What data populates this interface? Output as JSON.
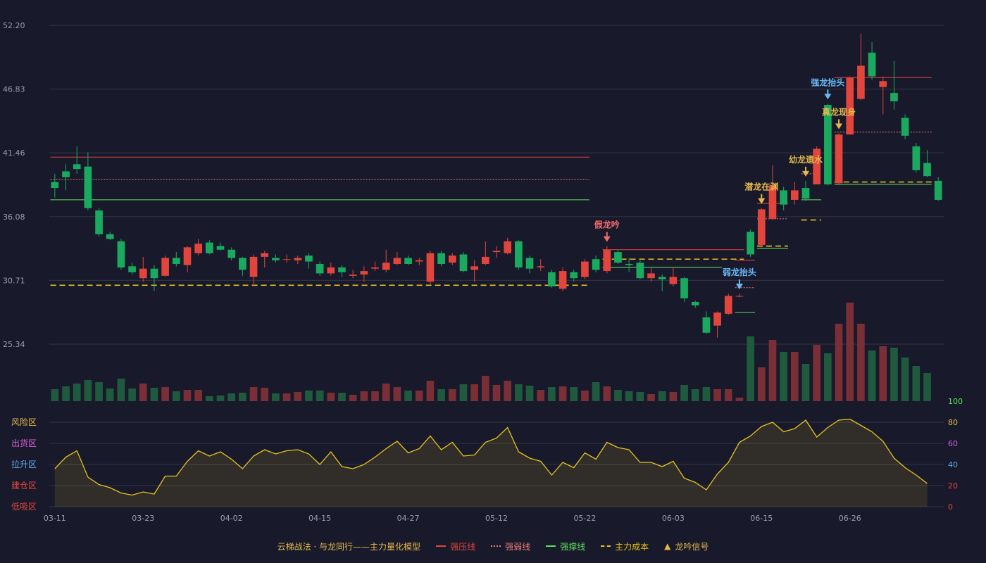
{
  "chart_data": {
    "type": "candlestick",
    "colors": {
      "up": "#e2453c",
      "down": "#1aaa5f",
      "background": "#181a2b",
      "grid": "#34374a",
      "axis_text": "#9a9db0",
      "resist": "#e2453c",
      "weak": "#f07a7a",
      "support": "#5fe05f",
      "cost": "#e8c31e",
      "osc": "#e8c31e"
    },
    "price_axis": {
      "min": 25.34,
      "max": 52.2,
      "ticks": [
        "52.20",
        "46.83",
        "41.46",
        "36.08",
        "30.71",
        "25.34"
      ]
    },
    "date_labels": [
      {
        "i": 0,
        "label": "03-11"
      },
      {
        "i": 8,
        "label": "03-23"
      },
      {
        "i": 16,
        "label": "04-02"
      },
      {
        "i": 24,
        "label": "04-15"
      },
      {
        "i": 32,
        "label": "04-27"
      },
      {
        "i": 40,
        "label": "05-12"
      },
      {
        "i": 48,
        "label": "05-22"
      },
      {
        "i": 56,
        "label": "06-03"
      },
      {
        "i": 64,
        "label": "06-15"
      },
      {
        "i": 72,
        "label": "06-26"
      }
    ],
    "candles": [
      [
        39.0,
        38.5,
        39.7,
        37.7
      ],
      [
        39.9,
        39.4,
        40.5,
        38.3
      ],
      [
        40.5,
        40.1,
        42.0,
        39.7
      ],
      [
        40.3,
        36.8,
        41.5,
        36.6
      ],
      [
        36.6,
        34.6,
        36.8,
        34.4
      ],
      [
        34.6,
        34.2,
        34.8,
        34.1
      ],
      [
        34.0,
        31.8,
        34.2,
        31.6
      ],
      [
        31.9,
        31.4,
        32.2,
        31.2
      ],
      [
        30.9,
        31.7,
        32.7,
        30.6
      ],
      [
        31.7,
        30.9,
        32.0,
        29.8
      ],
      [
        31.1,
        32.6,
        32.8,
        31.0
      ],
      [
        32.6,
        32.1,
        33.1,
        31.9
      ],
      [
        32.0,
        33.5,
        33.6,
        31.4
      ],
      [
        33.0,
        33.8,
        34.2,
        32.8
      ],
      [
        33.9,
        33.0,
        34.1,
        32.9
      ],
      [
        33.6,
        33.3,
        33.9,
        33.2
      ],
      [
        33.3,
        32.6,
        33.5,
        32.4
      ],
      [
        32.6,
        31.6,
        32.7,
        31.1
      ],
      [
        31.0,
        32.7,
        32.9,
        30.2
      ],
      [
        32.7,
        33.0,
        33.2,
        31.8
      ],
      [
        32.6,
        32.4,
        32.9,
        32.2
      ],
      [
        32.5,
        32.5,
        32.9,
        32.2
      ],
      [
        32.4,
        32.6,
        32.8,
        32.1
      ],
      [
        32.8,
        32.3,
        33.0,
        31.7
      ],
      [
        32.1,
        31.3,
        32.3,
        31.1
      ],
      [
        31.3,
        31.8,
        32.2,
        31.1
      ],
      [
        31.8,
        31.4,
        32.0,
        31.0
      ],
      [
        31.1,
        31.2,
        31.6,
        30.9
      ],
      [
        31.2,
        31.5,
        31.9,
        30.6
      ],
      [
        31.7,
        31.8,
        32.3,
        31.5
      ],
      [
        31.6,
        32.2,
        33.3,
        31.4
      ],
      [
        32.1,
        32.6,
        33.1,
        32.0
      ],
      [
        32.6,
        32.1,
        32.8,
        32.0
      ],
      [
        32.3,
        32.4,
        32.6,
        32.0
      ],
      [
        30.6,
        33.0,
        33.2,
        30.4
      ],
      [
        33.0,
        32.1,
        33.2,
        31.9
      ],
      [
        32.2,
        32.8,
        33.0,
        32.0
      ],
      [
        32.9,
        31.5,
        33.1,
        31.4
      ],
      [
        31.6,
        31.9,
        32.4,
        30.6
      ],
      [
        32.1,
        32.7,
        34.0,
        32.0
      ],
      [
        33.1,
        33.2,
        33.6,
        32.6
      ],
      [
        33.0,
        34.0,
        34.3,
        32.9
      ],
      [
        34.0,
        31.8,
        34.1,
        31.6
      ],
      [
        32.6,
        31.7,
        32.8,
        31.3
      ],
      [
        31.8,
        31.9,
        32.5,
        31.5
      ],
      [
        31.4,
        30.2,
        31.6,
        30.1
      ],
      [
        30.0,
        31.5,
        31.8,
        29.8
      ],
      [
        31.4,
        30.9,
        31.6,
        30.6
      ],
      [
        31.0,
        32.3,
        32.5,
        30.8
      ],
      [
        32.5,
        31.6,
        32.8,
        31.4
      ],
      [
        31.5,
        33.3,
        33.6,
        31.3
      ],
      [
        33.1,
        32.2,
        33.3,
        32.1
      ],
      [
        32.1,
        32.0,
        32.6,
        31.4
      ],
      [
        32.2,
        30.9,
        32.4,
        30.8
      ],
      [
        30.9,
        31.3,
        31.8,
        30.6
      ],
      [
        31.0,
        30.8,
        31.2,
        29.8
      ],
      [
        30.4,
        31.0,
        31.8,
        30.2
      ],
      [
        30.9,
        29.2,
        31.0,
        28.9
      ],
      [
        28.9,
        28.6,
        29.0,
        28.4
      ],
      [
        27.6,
        26.3,
        28.1,
        26.2
      ],
      [
        26.9,
        28.0,
        28.1,
        25.9
      ],
      [
        27.9,
        29.4,
        29.6,
        27.8
      ],
      [
        29.4,
        29.4,
        29.6,
        29.3
      ],
      [
        34.8,
        32.9,
        35.0,
        32.7
      ],
      [
        33.7,
        36.7,
        36.8,
        33.5
      ],
      [
        35.9,
        38.7,
        40.4,
        35.8
      ],
      [
        38.3,
        37.1,
        38.6,
        36.6
      ],
      [
        37.5,
        38.3,
        39.0,
        37.1
      ],
      [
        38.5,
        37.6,
        39.1,
        37.4
      ],
      [
        38.8,
        41.8,
        42.0,
        38.8
      ],
      [
        45.5,
        38.8,
        45.6,
        38.7
      ],
      [
        38.9,
        43.0,
        43.1,
        38.8
      ],
      [
        43.0,
        47.8,
        47.9,
        43.0
      ],
      [
        46.0,
        48.8,
        51.5,
        45.9
      ],
      [
        49.9,
        47.9,
        50.8,
        47.6
      ],
      [
        47.0,
        47.5,
        47.9,
        44.7
      ],
      [
        46.5,
        45.8,
        49.2,
        45.1
      ],
      [
        44.4,
        42.9,
        44.7,
        42.6
      ],
      [
        42.0,
        40.0,
        42.3,
        39.8
      ],
      [
        40.6,
        39.5,
        41.7,
        39.4
      ],
      [
        39.1,
        37.5,
        39.4,
        37.4
      ]
    ],
    "volume_heights": [
      17,
      21,
      25,
      30,
      27,
      18,
      32,
      18,
      25,
      19,
      20,
      14,
      16,
      16,
      7,
      8,
      11,
      12,
      20,
      19,
      11,
      11,
      13,
      15,
      15,
      12,
      12,
      9,
      14,
      14,
      25,
      20,
      15,
      15,
      29,
      17,
      17,
      24,
      24,
      36,
      23,
      29,
      24,
      22,
      16,
      20,
      21,
      20,
      15,
      27,
      21,
      16,
      14,
      13,
      10,
      14,
      13,
      23,
      17,
      20,
      17,
      17,
      5,
      92,
      48,
      87,
      70,
      70,
      53,
      80,
      68,
      110,
      140,
      110,
      72,
      78,
      76,
      62,
      50,
      40
    ],
    "volume_max_px": 140,
    "oscillator": {
      "axis_ticks": [
        "100",
        "80",
        "60",
        "40",
        "20",
        "0"
      ],
      "zones": [
        "风险区",
        "出货区",
        "拉升区",
        "建仓区",
        "低吸区"
      ],
      "values": [
        36,
        47,
        53,
        28,
        21,
        18,
        13,
        11,
        14,
        12,
        29,
        29,
        43,
        53,
        48,
        52,
        45,
        36,
        48,
        54,
        50,
        53,
        54,
        50,
        40,
        52,
        38,
        36,
        40,
        47,
        55,
        62,
        51,
        55,
        67,
        54,
        61,
        48,
        49,
        61,
        65,
        75,
        52,
        46,
        43,
        30,
        42,
        37,
        51,
        45,
        61,
        56,
        54,
        42,
        42,
        38,
        43,
        27,
        23,
        16,
        31,
        42,
        61,
        67,
        76,
        80,
        71,
        74,
        82,
        66,
        75,
        82,
        83,
        77,
        71,
        62,
        46,
        37,
        30,
        22
      ]
    },
    "signals": [
      {
        "i": 50,
        "label": "假龙吟",
        "color": "#f06a6a"
      },
      {
        "i": 62,
        "label": "弱龙抬头",
        "color": "#6ab8f5"
      },
      {
        "i": 64,
        "label": "潜龙在渊",
        "color": "#e6b84c"
      },
      {
        "i": 68,
        "label": "幼龙遗水",
        "color": "#e6b84c"
      },
      {
        "i": 70,
        "label": "强龙抬头",
        "color": "#6ab8f5"
      },
      {
        "i": 71,
        "label": "真龙现身",
        "color": "#e6b84c"
      }
    ],
    "levels": [
      {
        "kind": "resist",
        "from": 0,
        "to": 48,
        "value": 41.1
      },
      {
        "kind": "weak",
        "from": 0,
        "to": 48,
        "value": 39.2
      },
      {
        "kind": "support",
        "from": 0,
        "to": 48,
        "value": 37.5
      },
      {
        "kind": "cost",
        "from": 0,
        "to": 48,
        "value": 30.3
      },
      {
        "kind": "resist",
        "from": 50,
        "to": 62,
        "value": 33.3
      },
      {
        "kind": "cost",
        "from": 50,
        "to": 62,
        "value": 32.5
      },
      {
        "kind": "support",
        "from": 50,
        "to": 60,
        "value": 31.8
      },
      {
        "kind": "resist",
        "from": 62,
        "to": 63,
        "value": 32.4
      },
      {
        "kind": "weak",
        "from": 62,
        "to": 63,
        "value": 30.1
      },
      {
        "kind": "support",
        "from": 62,
        "to": 63,
        "value": 28.0
      },
      {
        "kind": "resist",
        "from": 64,
        "to": 66,
        "value": 37.2
      },
      {
        "kind": "weak",
        "from": 64,
        "to": 66,
        "value": 35.9
      },
      {
        "kind": "cost",
        "from": 64,
        "to": 66,
        "value": 33.6
      },
      {
        "kind": "support",
        "from": 64,
        "to": 66,
        "value": 33.4
      },
      {
        "kind": "weak",
        "from": 68,
        "to": 69,
        "value": 39.7
      },
      {
        "kind": "support",
        "from": 68,
        "to": 69,
        "value": 37.5
      },
      {
        "kind": "cost",
        "from": 68,
        "to": 69,
        "value": 35.8
      },
      {
        "kind": "resist",
        "from": 71,
        "to": 79,
        "value": 47.8
      },
      {
        "kind": "weak",
        "from": 71,
        "to": 79,
        "value": 43.2
      },
      {
        "kind": "cost",
        "from": 71,
        "to": 79,
        "value": 39.0
      },
      {
        "kind": "support",
        "from": 71,
        "to": 79,
        "value": 38.8
      }
    ],
    "legend": {
      "title": "云梯战法 · 与龙同行——主力量化模型",
      "items": [
        {
          "kind": "resist",
          "label": "强压线"
        },
        {
          "kind": "weak",
          "label": "强弱线"
        },
        {
          "kind": "support",
          "label": "强撑线"
        },
        {
          "kind": "cost",
          "label": "主力成本"
        },
        {
          "kind": "signal",
          "label": "龙吟信号"
        }
      ]
    }
  }
}
